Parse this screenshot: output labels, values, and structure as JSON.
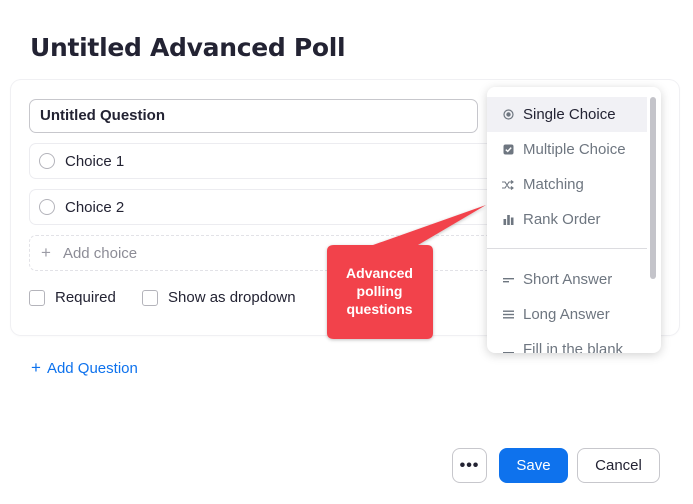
{
  "page": {
    "title": "Untitled Advanced Poll"
  },
  "question": {
    "title_value": "Untitled Question",
    "choices": [
      {
        "label": "Choice 1"
      },
      {
        "label": "Choice 2"
      }
    ],
    "add_choice_label": "Add choice",
    "add_choice_icon": "plus-icon",
    "options": {
      "required_label": "Required",
      "dropdown_label": "Show as dropdown"
    }
  },
  "add_question": {
    "label": "Add Question",
    "icon": "plus-icon"
  },
  "question_type_menu": {
    "selected": "Single Choice",
    "items": [
      {
        "label": "Single Choice",
        "icon": "radio-dot-icon"
      },
      {
        "label": "Multiple Choice",
        "icon": "checkbox-checked-icon"
      },
      {
        "label": "Matching",
        "icon": "shuffle-icon"
      },
      {
        "label": "Rank Order",
        "icon": "bar-chart-icon"
      },
      {
        "label": "Short Answer",
        "icon": "short-lines-icon"
      },
      {
        "label": "Long Answer",
        "icon": "long-lines-icon"
      },
      {
        "label": "Fill in the blank",
        "icon": "fill-blank-icon"
      }
    ]
  },
  "callout": {
    "text": "Advanced polling questions",
    "color": "#f2424b"
  },
  "footer": {
    "more_label": "•••",
    "save_label": "Save",
    "cancel_label": "Cancel"
  },
  "colors": {
    "accent": "#0e72ed",
    "text": "#232333",
    "muted": "#6e7680"
  }
}
